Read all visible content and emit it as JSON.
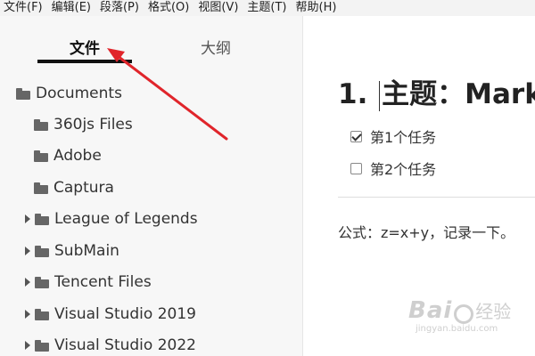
{
  "menubar": {
    "items": [
      "文件(F)",
      "编辑(E)",
      "段落(P)",
      "格式(O)",
      "视图(V)",
      "主题(T)",
      "帮助(H)"
    ]
  },
  "sidebar": {
    "tabs": {
      "files": "文件",
      "outline": "大纲"
    },
    "tree": [
      {
        "label": "Documents",
        "level": 0,
        "expandable": false
      },
      {
        "label": "360js Files",
        "level": 1,
        "expandable": false
      },
      {
        "label": "Adobe",
        "level": 1,
        "expandable": false
      },
      {
        "label": "Captura",
        "level": 1,
        "expandable": false
      },
      {
        "label": "League of Legends",
        "level": 1,
        "expandable": true
      },
      {
        "label": "SubMain",
        "level": 1,
        "expandable": true
      },
      {
        "label": "Tencent Files",
        "level": 1,
        "expandable": true
      },
      {
        "label": "Visual Studio 2019",
        "level": 1,
        "expandable": true
      },
      {
        "label": "Visual Studio 2022",
        "level": 1,
        "expandable": true
      }
    ]
  },
  "editor": {
    "heading_number": "1.",
    "heading_text": "主题：Markdown",
    "tasks": [
      {
        "label": "第1个任务",
        "checked": true
      },
      {
        "label": "第2个任务",
        "checked": false
      }
    ],
    "formula": "公式：z=x+y，记录一下。"
  },
  "watermark": {
    "logo_left": "Bai",
    "logo_suffix": "经验",
    "url": "jingyan.baidu.com"
  },
  "colors": {
    "annotation_arrow": "#e0252b",
    "sidebar_bg": "#f7f7f7",
    "menubar_bg": "#f3f3f3"
  }
}
